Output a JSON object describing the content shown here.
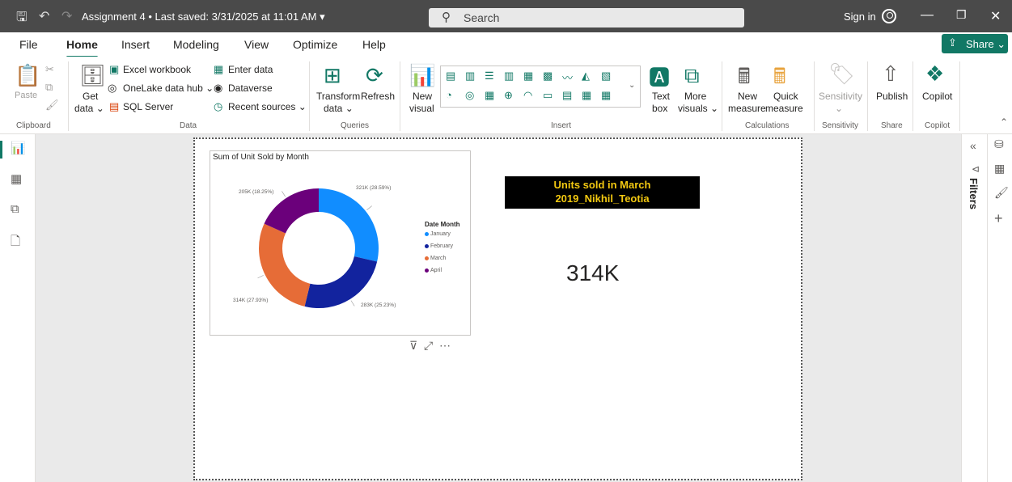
{
  "titlebar": {
    "title": "Assignment 4 • Last saved: 3/31/2025 at 11:01 AM ▾",
    "search_placeholder": "Search",
    "sign_in": "Sign in"
  },
  "menu": {
    "items": [
      "File",
      "Home",
      "Insert",
      "Modeling",
      "View",
      "Optimize",
      "Help"
    ],
    "active": "Home",
    "share": "Share ⌄"
  },
  "ribbon": {
    "clipboard": {
      "paste": "Paste",
      "group": "Clipboard"
    },
    "data": {
      "get_data_1": "Get",
      "get_data_2": "data ⌄",
      "excel": "Excel workbook",
      "onelake": "OneLake data hub ⌄",
      "sql": "SQL Server",
      "enter_data": "Enter data",
      "dataverse": "Dataverse",
      "recent": "Recent sources ⌄",
      "group": "Data"
    },
    "queries": {
      "transform_1": "Transform",
      "transform_2": "data ⌄",
      "refresh": "Refresh",
      "group": "Queries"
    },
    "insert": {
      "new_visual_1": "New",
      "new_visual_2": "visual",
      "text_box_1": "Text",
      "text_box_2": "box",
      "more_visuals_1": "More",
      "more_visuals_2": "visuals ⌄",
      "group": "Insert"
    },
    "calculations": {
      "new_measure_1": "New",
      "new_measure_2": "measure",
      "quick_measure_1": "Quick",
      "quick_measure_2": "measure",
      "group": "Calculations"
    },
    "sensitivity": {
      "label": "Sensitivity",
      "sub": "⌄",
      "group": "Sensitivity"
    },
    "share": {
      "publish": "Publish",
      "group": "Share"
    },
    "copilot": {
      "label": "Copilot",
      "group": "Copilot"
    }
  },
  "report": {
    "donut_visual": {
      "title": "Sum of Unit Sold by Month",
      "legend_title": "Date Month"
    },
    "title_box": {
      "line1": "Units sold in March",
      "line2": "2019_Nikhil_Teotia"
    },
    "card_value": "314K"
  },
  "filters_pane": {
    "label": "Filters"
  },
  "chart_data": {
    "type": "pie",
    "title": "Sum of Unit Sold by Month",
    "legend_title": "Date Month",
    "categories": [
      "January",
      "February",
      "March",
      "April"
    ],
    "values": [
      321,
      283,
      314,
      205
    ],
    "value_unit": "K",
    "labels": [
      "321K (28.59%)",
      "283K (25.23%)",
      "314K (27.93%)",
      "205K (18.25%)"
    ],
    "colors": [
      "#118dff",
      "#12239e",
      "#e66c37",
      "#6b007b"
    ],
    "legend_position": "right"
  }
}
